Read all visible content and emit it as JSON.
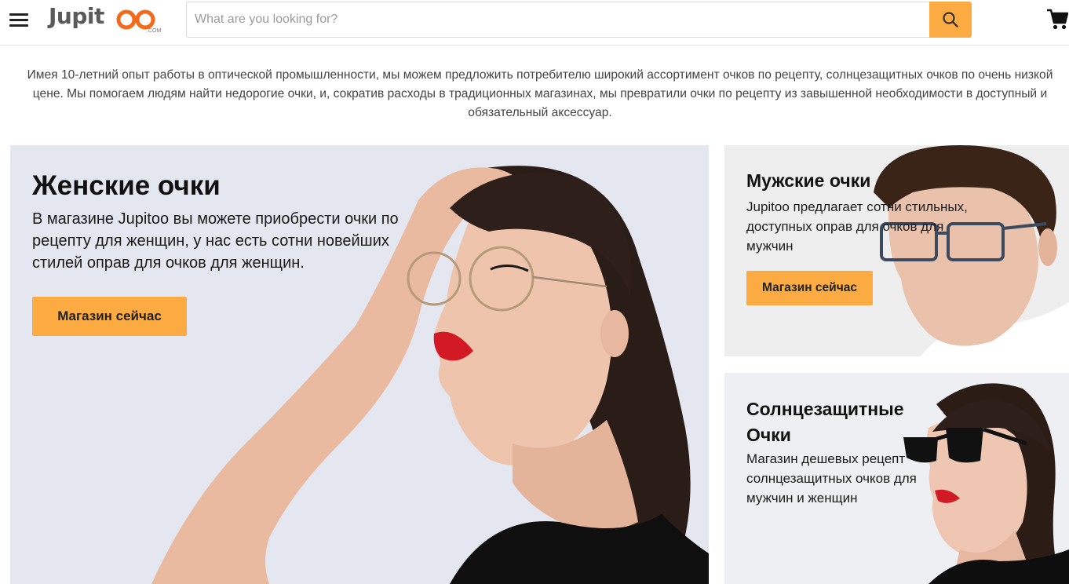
{
  "header": {
    "logo_text": "Jupit",
    "logo_suffix": ".COM",
    "search_placeholder": "What are you looking for?"
  },
  "intro": {
    "text": "Имея 10-летний опыт работы в оптической промышленности, мы можем предложить потребителю широкий ассортимент очков по рецепту, солнцезащитных очков по очень низкой цене. Мы помогаем людям найти недорогие очки, и, сократив расходы в традиционных магазинах, мы превратили очки по рецепту из завышенной необходимости в доступный и обязательный аксессуар."
  },
  "banners": {
    "women": {
      "title": "Женские очки",
      "description": "В магазине Jupitoo вы можете приобрести очки по рецепту для женщин, у нас есть сотни новейших стилей оправ для очков для женщин.",
      "button": "Магазин сейчас"
    },
    "men": {
      "title": "Мужские очки",
      "description": "Jupitoo предлагает сотни стильных, доступных оправ для очков для мужчин",
      "button": "Магазин сейчас"
    },
    "sun": {
      "title": "Солнцезащитные Очки",
      "description": "Магазин дешевых рецепт солнцезащитных очков для мужчин и женщин"
    }
  },
  "colors": {
    "accent": "#fbab41",
    "logo_orange": "#f26b1d",
    "logo_gray": "#5a5a5a"
  },
  "icons": {
    "menu": "hamburger-icon",
    "search": "search-icon",
    "cart": "cart-icon"
  }
}
